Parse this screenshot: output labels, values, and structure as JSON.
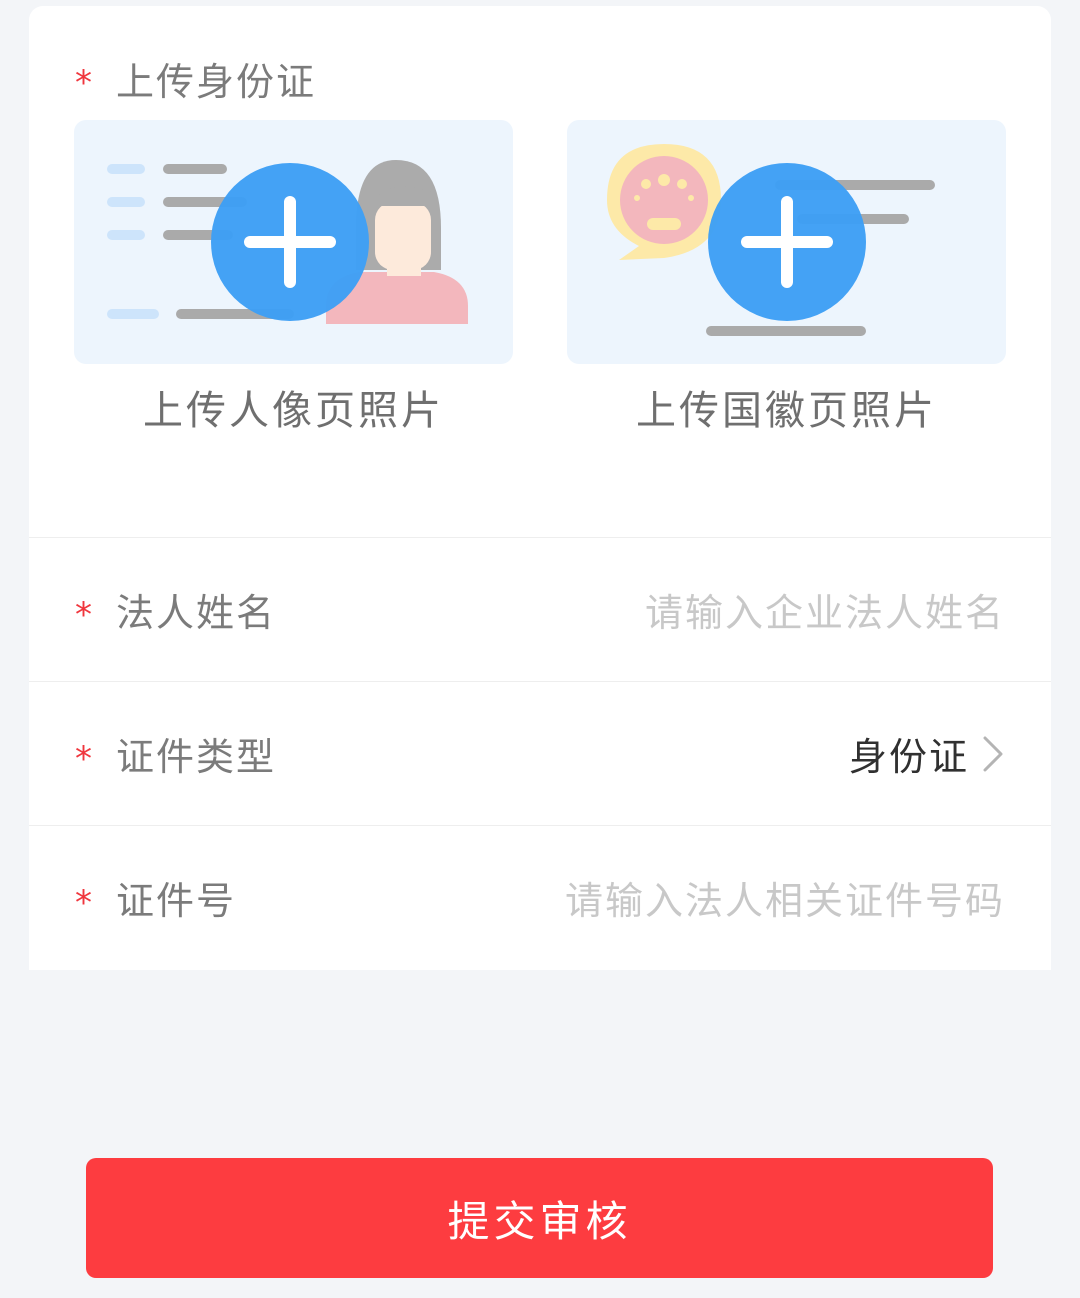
{
  "id_upload": {
    "required_mark": "*",
    "title": "上传身份证",
    "front": {
      "caption": "上传人像页照片",
      "icon": "add-photo-icon"
    },
    "back": {
      "caption": "上传国徽页照片",
      "icon": "add-photo-icon"
    }
  },
  "form": {
    "legal_name": {
      "required_mark": "*",
      "label": "法人姓名",
      "placeholder": "请输入企业法人姓名"
    },
    "id_type": {
      "required_mark": "*",
      "label": "证件类型",
      "value": "身份证",
      "icon": "chevron-right-icon"
    },
    "id_number": {
      "required_mark": "*",
      "label": "证件号",
      "placeholder": "请输入法人相关证件号码"
    }
  },
  "submit": {
    "label": "提交审核"
  },
  "colors": {
    "accent": "#fd3c40",
    "required": "#f0363d",
    "plus_circle": "#3e9ff5",
    "upload_bg": "#edf5fd",
    "page_bg": "#f3f5f8"
  }
}
